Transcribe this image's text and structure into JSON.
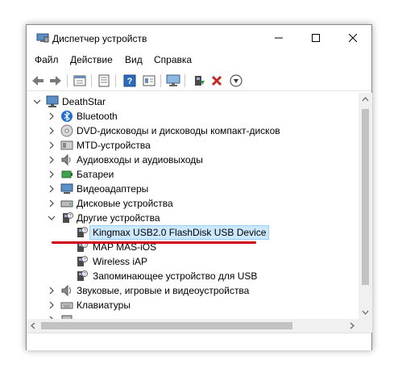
{
  "window": {
    "title": "Диспетчер устройств"
  },
  "menu": {
    "file": "Файл",
    "action": "Действие",
    "view": "Вид",
    "help": "Справка"
  },
  "toolbar_icons": [
    "back-icon",
    "forward-icon",
    "properties-icon",
    "show-hide-icon",
    "help-icon",
    "driver-icon",
    "scan-monitor-icon",
    "update-driver-icon",
    "uninstall-icon",
    "download-icon"
  ],
  "tree": {
    "root": "DeathStar",
    "categories": {
      "bluetooth": "Bluetooth",
      "dvd": "DVD-дисководы и дисководы компакт-дисков",
      "mtd": "MTD-устройства",
      "audio_io": "Аудиовходы и аудиовыходы",
      "batteries": "Батареи",
      "video": "Видеоадаптеры",
      "disks": "Дисковые устройства",
      "other": "Другие устройства",
      "sound": "Звуковые, игровые и видеоустройства",
      "keyboards": "Клавиатуры"
    },
    "other_children": {
      "kingmax": "Kingmax USB2.0 FlashDisk USB Device",
      "map": "MAP MAS-iOS",
      "wireless": "Wireless iAP",
      "storage": "Запоминающее устройство для USB"
    }
  },
  "colors": {
    "selection_bg": "#cce8ff",
    "selection_border": "#99d1ff",
    "highlight_underline": "#d0021b"
  }
}
